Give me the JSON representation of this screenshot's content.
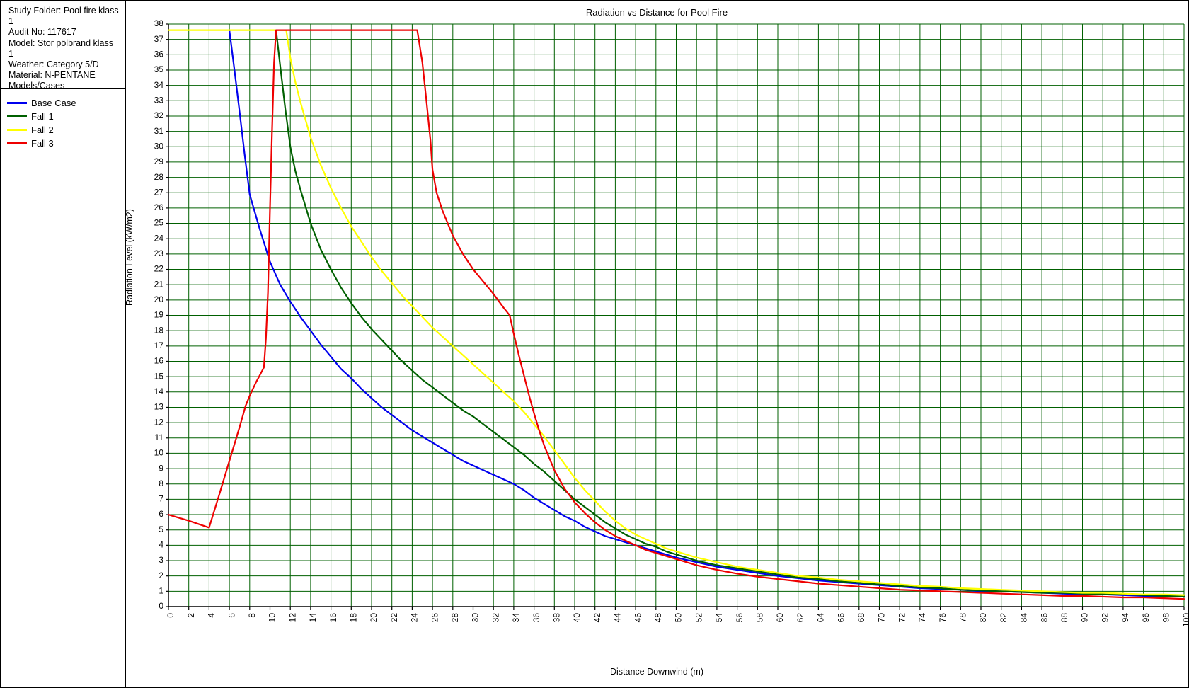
{
  "info_panel": {
    "study_folder": "Study Folder: Pool fire klass 1",
    "audit_no": "Audit No: 117617",
    "model": "Model: Stor pölbrand klass 1",
    "weather": "Weather: Category 5/D",
    "material": "Material: N-PENTANE",
    "models_cases": "Models/Cases"
  },
  "legend": {
    "items": [
      {
        "label": "Base Case",
        "color": "#0000ee"
      },
      {
        "label": "Fall 1",
        "color": "#006000"
      },
      {
        "label": "Fall 2",
        "color": "#ffff00"
      },
      {
        "label": "Fall 3",
        "color": "#ee0000"
      }
    ]
  },
  "chart_data": {
    "type": "line",
    "title": "Radiation vs Distance for Pool Fire",
    "xlabel": "Distance Downwind (m)",
    "ylabel": "Radiation Level (kW/m2)",
    "xlim": [
      0,
      100
    ],
    "ylim": [
      0,
      38
    ],
    "xtick_step": 2,
    "ytick_step": 1,
    "grid": true,
    "grid_color": "#006000",
    "legend_position": "left-panel",
    "xticks": [
      0,
      2,
      4,
      6,
      8,
      10,
      12,
      14,
      16,
      18,
      20,
      22,
      24,
      26,
      28,
      30,
      32,
      34,
      36,
      38,
      40,
      42,
      44,
      46,
      48,
      50,
      52,
      54,
      56,
      58,
      60,
      62,
      64,
      66,
      68,
      70,
      72,
      74,
      76,
      78,
      80,
      82,
      84,
      86,
      88,
      90,
      92,
      94,
      96,
      98,
      100
    ],
    "yticks": [
      0,
      1,
      2,
      3,
      4,
      5,
      6,
      7,
      8,
      9,
      10,
      11,
      12,
      13,
      14,
      15,
      16,
      17,
      18,
      19,
      20,
      21,
      22,
      23,
      24,
      25,
      26,
      27,
      28,
      29,
      30,
      31,
      32,
      33,
      34,
      35,
      36,
      37,
      38
    ],
    "series": [
      {
        "name": "Base Case",
        "color": "#0000ee",
        "points": [
          [
            6.0,
            37.6
          ],
          [
            6.5,
            35.0
          ],
          [
            7.0,
            32.3
          ],
          [
            7.5,
            29.5
          ],
          [
            8.0,
            26.9
          ],
          [
            8.3,
            26.2
          ],
          [
            9.0,
            24.6
          ],
          [
            10.0,
            22.5
          ],
          [
            11.0,
            21.0
          ],
          [
            12.0,
            19.9
          ],
          [
            13.0,
            18.9
          ],
          [
            14.0,
            18.0
          ],
          [
            15.0,
            17.1
          ],
          [
            16.0,
            16.3
          ],
          [
            17.0,
            15.5
          ],
          [
            18.0,
            14.9
          ],
          [
            19.0,
            14.2
          ],
          [
            20.0,
            13.6
          ],
          [
            21.0,
            13.0
          ],
          [
            22.0,
            12.5
          ],
          [
            23.0,
            12.0
          ],
          [
            24.0,
            11.5
          ],
          [
            25.0,
            11.1
          ],
          [
            26.0,
            10.7
          ],
          [
            27.0,
            10.3
          ],
          [
            28.0,
            9.9
          ],
          [
            29.0,
            9.5
          ],
          [
            30.0,
            9.2
          ],
          [
            31.0,
            8.9
          ],
          [
            32.0,
            8.6
          ],
          [
            33.0,
            8.3
          ],
          [
            34.0,
            8.0
          ],
          [
            35.0,
            7.6
          ],
          [
            36.0,
            7.1
          ],
          [
            37.0,
            6.7
          ],
          [
            38.0,
            6.3
          ],
          [
            39.0,
            5.9
          ],
          [
            40.0,
            5.6
          ],
          [
            41.0,
            5.2
          ],
          [
            42.0,
            4.9
          ],
          [
            43.0,
            4.6
          ],
          [
            44.0,
            4.4
          ],
          [
            45.0,
            4.2
          ],
          [
            46.0,
            4.0
          ],
          [
            47.0,
            3.8
          ],
          [
            48.0,
            3.6
          ],
          [
            49.0,
            3.4
          ],
          [
            50.0,
            3.2
          ],
          [
            52.0,
            2.9
          ],
          [
            54.0,
            2.6
          ],
          [
            56.0,
            2.4
          ],
          [
            58.0,
            2.2
          ],
          [
            60.0,
            2.0
          ],
          [
            62.0,
            1.85
          ],
          [
            64.0,
            1.7
          ],
          [
            66.0,
            1.6
          ],
          [
            68.0,
            1.5
          ],
          [
            70.0,
            1.4
          ],
          [
            72.0,
            1.3
          ],
          [
            74.0,
            1.2
          ],
          [
            76.0,
            1.15
          ],
          [
            78.0,
            1.1
          ],
          [
            80.0,
            1.0
          ],
          [
            82.0,
            1.0
          ],
          [
            84.0,
            0.95
          ],
          [
            86.0,
            0.9
          ],
          [
            88.0,
            0.85
          ],
          [
            90.0,
            0.8
          ],
          [
            92.0,
            0.8
          ],
          [
            94.0,
            0.75
          ],
          [
            96.0,
            0.7
          ],
          [
            98.0,
            0.7
          ],
          [
            100.0,
            0.65
          ]
        ]
      },
      {
        "name": "Fall 1",
        "color": "#006000",
        "points": [
          [
            10.6,
            37.6
          ],
          [
            11.0,
            35.3
          ],
          [
            11.5,
            32.5
          ],
          [
            12.0,
            30.0
          ],
          [
            12.5,
            28.4
          ],
          [
            13.0,
            27.2
          ],
          [
            14.0,
            25.0
          ],
          [
            15.0,
            23.3
          ],
          [
            16.0,
            22.0
          ],
          [
            17.0,
            20.8
          ],
          [
            18.0,
            19.8
          ],
          [
            19.0,
            18.9
          ],
          [
            20.0,
            18.1
          ],
          [
            21.0,
            17.4
          ],
          [
            22.0,
            16.7
          ],
          [
            23.0,
            16.0
          ],
          [
            24.0,
            15.4
          ],
          [
            25.0,
            14.8
          ],
          [
            26.0,
            14.3
          ],
          [
            27.0,
            13.8
          ],
          [
            28.0,
            13.3
          ],
          [
            29.0,
            12.8
          ],
          [
            30.0,
            12.4
          ],
          [
            31.0,
            11.9
          ],
          [
            32.0,
            11.4
          ],
          [
            33.0,
            10.9
          ],
          [
            34.0,
            10.4
          ],
          [
            35.0,
            9.9
          ],
          [
            36.0,
            9.3
          ],
          [
            37.0,
            8.8
          ],
          [
            38.0,
            8.2
          ],
          [
            39.0,
            7.6
          ],
          [
            40.0,
            7.0
          ],
          [
            41.0,
            6.5
          ],
          [
            42.0,
            6.0
          ],
          [
            43.0,
            5.5
          ],
          [
            44.0,
            5.1
          ],
          [
            45.0,
            4.7
          ],
          [
            46.0,
            4.4
          ],
          [
            47.0,
            4.1
          ],
          [
            48.0,
            3.9
          ],
          [
            49.0,
            3.6
          ],
          [
            50.0,
            3.4
          ],
          [
            52.0,
            3.0
          ],
          [
            54.0,
            2.7
          ],
          [
            56.0,
            2.5
          ],
          [
            58.0,
            2.3
          ],
          [
            60.0,
            2.1
          ],
          [
            62.0,
            1.9
          ],
          [
            64.0,
            1.8
          ],
          [
            66.0,
            1.65
          ],
          [
            68.0,
            1.55
          ],
          [
            70.0,
            1.45
          ],
          [
            72.0,
            1.35
          ],
          [
            74.0,
            1.25
          ],
          [
            76.0,
            1.2
          ],
          [
            78.0,
            1.1
          ],
          [
            80.0,
            1.05
          ],
          [
            82.0,
            1.0
          ],
          [
            84.0,
            0.95
          ],
          [
            86.0,
            0.9
          ],
          [
            88.0,
            0.9
          ],
          [
            90.0,
            0.85
          ],
          [
            92.0,
            0.8
          ],
          [
            94.0,
            0.8
          ],
          [
            96.0,
            0.75
          ],
          [
            98.0,
            0.7
          ],
          [
            100.0,
            0.7
          ]
        ]
      },
      {
        "name": "Fall 2",
        "color": "#ffff00",
        "points": [
          [
            0.0,
            37.6
          ],
          [
            11.0,
            37.6
          ],
          [
            11.6,
            37.6
          ],
          [
            12.0,
            35.8
          ],
          [
            12.5,
            34.2
          ],
          [
            13.0,
            32.9
          ],
          [
            14.0,
            30.6
          ],
          [
            15.0,
            28.8
          ],
          [
            16.0,
            27.3
          ],
          [
            17.0,
            26.0
          ],
          [
            18.0,
            24.8
          ],
          [
            19.0,
            23.8
          ],
          [
            20.0,
            22.8
          ],
          [
            21.0,
            21.9
          ],
          [
            22.0,
            21.1
          ],
          [
            23.0,
            20.3
          ],
          [
            24.0,
            19.6
          ],
          [
            25.0,
            18.9
          ],
          [
            26.0,
            18.2
          ],
          [
            27.0,
            17.6
          ],
          [
            28.0,
            17.0
          ],
          [
            29.0,
            16.4
          ],
          [
            30.0,
            15.8
          ],
          [
            31.0,
            15.2
          ],
          [
            32.0,
            14.6
          ],
          [
            33.0,
            14.0
          ],
          [
            34.0,
            13.4
          ],
          [
            35.0,
            12.7
          ],
          [
            36.0,
            11.9
          ],
          [
            37.0,
            11.1
          ],
          [
            38.0,
            10.2
          ],
          [
            39.0,
            9.3
          ],
          [
            40.0,
            8.4
          ],
          [
            41.0,
            7.6
          ],
          [
            42.0,
            6.9
          ],
          [
            43.0,
            6.2
          ],
          [
            44.0,
            5.6
          ],
          [
            45.0,
            5.1
          ],
          [
            46.0,
            4.7
          ],
          [
            47.0,
            4.4
          ],
          [
            48.0,
            4.1
          ],
          [
            49.0,
            3.8
          ],
          [
            50.0,
            3.6
          ],
          [
            52.0,
            3.2
          ],
          [
            54.0,
            2.9
          ],
          [
            56.0,
            2.6
          ],
          [
            58.0,
            2.4
          ],
          [
            60.0,
            2.2
          ],
          [
            62.0,
            2.0
          ],
          [
            64.0,
            1.9
          ],
          [
            66.0,
            1.75
          ],
          [
            68.0,
            1.65
          ],
          [
            70.0,
            1.55
          ],
          [
            72.0,
            1.45
          ],
          [
            74.0,
            1.35
          ],
          [
            76.0,
            1.3
          ],
          [
            78.0,
            1.2
          ],
          [
            80.0,
            1.15
          ],
          [
            82.0,
            1.1
          ],
          [
            84.0,
            1.05
          ],
          [
            86.0,
            1.0
          ],
          [
            88.0,
            0.95
          ],
          [
            90.0,
            0.9
          ],
          [
            92.0,
            0.9
          ],
          [
            94.0,
            0.85
          ],
          [
            96.0,
            0.8
          ],
          [
            98.0,
            0.8
          ],
          [
            100.0,
            0.75
          ]
        ]
      },
      {
        "name": "Fall 3",
        "color": "#ee0000",
        "points": [
          [
            0.0,
            6.0
          ],
          [
            2.0,
            5.6
          ],
          [
            4.0,
            5.15
          ],
          [
            5.0,
            7.3
          ],
          [
            6.0,
            9.5
          ],
          [
            7.0,
            11.7
          ],
          [
            7.6,
            13.1
          ],
          [
            8.0,
            13.75
          ],
          [
            8.6,
            14.6
          ],
          [
            9.0,
            15.1
          ],
          [
            9.4,
            15.6
          ],
          [
            9.6,
            17.5
          ],
          [
            9.8,
            20.5
          ],
          [
            10.0,
            26.0
          ],
          [
            10.2,
            31.0
          ],
          [
            10.4,
            35.5
          ],
          [
            10.6,
            37.6
          ],
          [
            24.5,
            37.6
          ],
          [
            25.0,
            35.5
          ],
          [
            25.4,
            33.0
          ],
          [
            25.8,
            30.4
          ],
          [
            26.0,
            28.5
          ],
          [
            26.4,
            27.0
          ],
          [
            27.0,
            25.8
          ],
          [
            28.0,
            24.2
          ],
          [
            29.0,
            23.0
          ],
          [
            30.0,
            22.0
          ],
          [
            31.0,
            21.2
          ],
          [
            32.0,
            20.4
          ],
          [
            33.0,
            19.5
          ],
          [
            33.6,
            19.0
          ],
          [
            34.0,
            17.8
          ],
          [
            34.5,
            16.4
          ],
          [
            35.0,
            15.1
          ],
          [
            35.5,
            13.8
          ],
          [
            36.0,
            12.6
          ],
          [
            36.5,
            11.5
          ],
          [
            37.0,
            10.5
          ],
          [
            37.5,
            9.7
          ],
          [
            38.0,
            8.9
          ],
          [
            39.0,
            7.7
          ],
          [
            40.0,
            6.8
          ],
          [
            41.0,
            6.1
          ],
          [
            42.0,
            5.5
          ],
          [
            43.0,
            5.0
          ],
          [
            44.0,
            4.6
          ],
          [
            45.0,
            4.3
          ],
          [
            46.0,
            4.0
          ],
          [
            47.0,
            3.7
          ],
          [
            48.0,
            3.5
          ],
          [
            49.0,
            3.3
          ],
          [
            50.0,
            3.1
          ],
          [
            52.0,
            2.7
          ],
          [
            54.0,
            2.4
          ],
          [
            56.0,
            2.15
          ],
          [
            58.0,
            1.95
          ],
          [
            60.0,
            1.8
          ],
          [
            62.0,
            1.65
          ],
          [
            64.0,
            1.5
          ],
          [
            66.0,
            1.4
          ],
          [
            68.0,
            1.3
          ],
          [
            70.0,
            1.2
          ],
          [
            72.0,
            1.1
          ],
          [
            74.0,
            1.05
          ],
          [
            76.0,
            1.0
          ],
          [
            78.0,
            0.95
          ],
          [
            80.0,
            0.9
          ],
          [
            82.0,
            0.85
          ],
          [
            84.0,
            0.8
          ],
          [
            86.0,
            0.75
          ],
          [
            88.0,
            0.7
          ],
          [
            90.0,
            0.7
          ],
          [
            92.0,
            0.65
          ],
          [
            94.0,
            0.6
          ],
          [
            96.0,
            0.6
          ],
          [
            98.0,
            0.55
          ],
          [
            100.0,
            0.5
          ]
        ]
      }
    ]
  }
}
